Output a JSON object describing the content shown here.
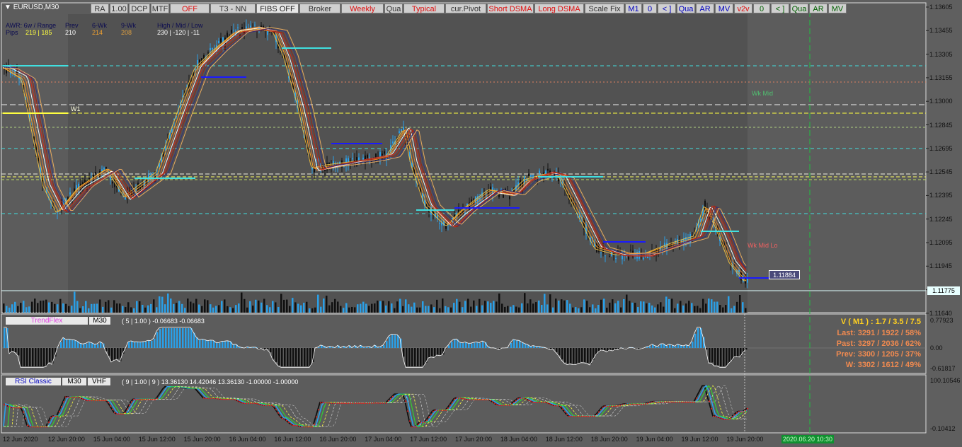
{
  "symbol": "EURUSD,M30",
  "toolbar": {
    "buttons": [
      "RA",
      "1.00",
      "DCP",
      "MTF",
      "OFF",
      "T3 - NN",
      "FIBS OFF",
      "Broker",
      "Weekly",
      "Qua",
      "Typical",
      "cur.Pivot",
      "Short DSMA",
      "Long DSMA",
      "Scale Fix",
      "M1",
      "0",
      "< ]",
      "Qua",
      "AR",
      "MV",
      "v2v",
      "0",
      "< ]",
      "Qua",
      "AR",
      "MV"
    ]
  },
  "awr": {
    "line1": "AWR:  6w / Range",
    "pips_label": "Pips",
    "pips_value": "219 | 185",
    "prev_label": "Prev",
    "prev_value": "210",
    "wk6_label": "6-Wk",
    "wk6_value": "214",
    "wk9_label": "9-Wk",
    "wk9_value": "208",
    "hml_label": "High / Mid / Low",
    "hml_value": "230  |  -120  |  -11"
  },
  "levels": {
    "w1": "W1",
    "wk_mid": "Wk Mid",
    "wk_mid_lo": "Wk Mid Lo",
    "current_price_box": "1.11884"
  },
  "price_axis": [
    "1.13605",
    "1.13455",
    "1.13305",
    "1.13155",
    "1.13000",
    "1.12845",
    "1.12695",
    "1.12545",
    "1.12395",
    "1.12245",
    "1.12095",
    "1.11945",
    "1.11775",
    "1.11640"
  ],
  "current_price": "1.11775",
  "trendflex": {
    "name": "TrendFlex",
    "tf": "M30",
    "params": "( 5 | 1.00 ) -0.06683 -0.06683",
    "axis": [
      "0.77923",
      "0.00",
      "-0.61817"
    ]
  },
  "rsi": {
    "name": "RSI Classic",
    "tf": "M30",
    "mode": "VHF",
    "params": "( 9 | 1.00 | 9 ) 13.36130 14.42046 13.36130 -1.00000 -1.00000",
    "axis": [
      "100.10546",
      "-0.10412"
    ]
  },
  "stats": {
    "v": "V ( M1 ) : 1.7 / 3.5 / 7.5",
    "last": "Last: 3291 / 1922 / 58%",
    "past": "Past: 3297 / 2036 / 62%",
    "prev": "Prev: 3300 / 1205 / 37%",
    "w": "W: 3302 / 1612 / 49%"
  },
  "time_axis": [
    "12 Jun 2020",
    "12 Jun 20:00",
    "15 Jun 04:00",
    "15 Jun 12:00",
    "15 Jun 20:00",
    "16 Jun 04:00",
    "16 Jun 12:00",
    "16 Jun 20:00",
    "17 Jun 04:00",
    "17 Jun 12:00",
    "17 Jun 20:00",
    "18 Jun 04:00",
    "18 Jun 12:00",
    "18 Jun 20:00",
    "19 Jun 04:00",
    "19 Jun 12:00",
    "19 Jun 20:00"
  ],
  "cursor_time": "2020.06.20 10:30",
  "chart_data": {
    "type": "candlestick",
    "symbol": "EURUSD",
    "timeframe": "M30",
    "x": [
      "12 Jun 2020",
      "12 Jun 20:00",
      "15 Jun 04:00",
      "15 Jun 12:00",
      "15 Jun 20:00",
      "16 Jun 04:00",
      "16 Jun 12:00",
      "16 Jun 20:00",
      "17 Jun 04:00",
      "17 Jun 12:00",
      "17 Jun 20:00",
      "18 Jun 04:00",
      "18 Jun 12:00",
      "18 Jun 20:00",
      "19 Jun 04:00",
      "19 Jun 12:00",
      "19 Jun 20:00"
    ],
    "close": [
      1.1318,
      1.1245,
      1.125,
      1.1265,
      1.135,
      1.1345,
      1.1265,
      1.127,
      1.1275,
      1.1228,
      1.1235,
      1.1255,
      1.1248,
      1.121,
      1.1222,
      1.122,
      1.1178
    ],
    "ylim": [
      1.1164,
      1.1365
    ]
  },
  "colors": {
    "bg": "#5f5f5f",
    "plot": "#545454",
    "volume": "#2aa0e8",
    "cyan": "#40e0e0",
    "blue_level": "#1a1aff",
    "yellow": "#ffff40",
    "ma_red": "#c03020",
    "ma_orange": "#f0a030"
  }
}
